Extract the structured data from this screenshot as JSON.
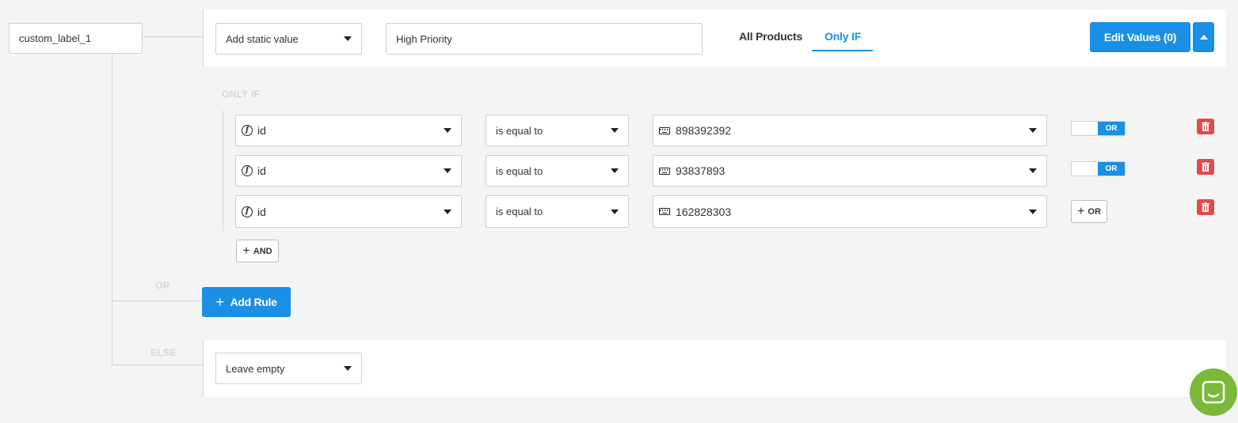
{
  "root_label": "custom_label_1",
  "rule": {
    "value_type": "Add static value",
    "value_input": "High Priority",
    "tabs": [
      {
        "label": "All Products",
        "active": false
      },
      {
        "label": "Only IF",
        "active": true
      }
    ],
    "edit_values_label": "Edit Values (0)",
    "only_if_heading": "ONLY IF",
    "conditions": [
      {
        "field": "id",
        "operator": "is equal to",
        "value": "898392392",
        "connector": "OR"
      },
      {
        "field": "id",
        "operator": "is equal to",
        "value": "93837893",
        "connector": "OR"
      },
      {
        "field": "id",
        "operator": "is equal to",
        "value": "162828303",
        "connector_button": "OR"
      }
    ],
    "and_button_label": "AND"
  },
  "or_label": "OR",
  "add_rule_label": "Add Rule",
  "else_label": "ELSE",
  "else_value": "Leave empty",
  "colors": {
    "accent": "#1a8fe3",
    "danger": "#e24b4b",
    "chat": "#7cb83a",
    "background": "#f4f4f4"
  },
  "icons": [
    "caret-down-icon",
    "caret-up-icon",
    "function-icon",
    "keyboard-icon",
    "trash-icon",
    "plus-icon",
    "chat-icon"
  ]
}
